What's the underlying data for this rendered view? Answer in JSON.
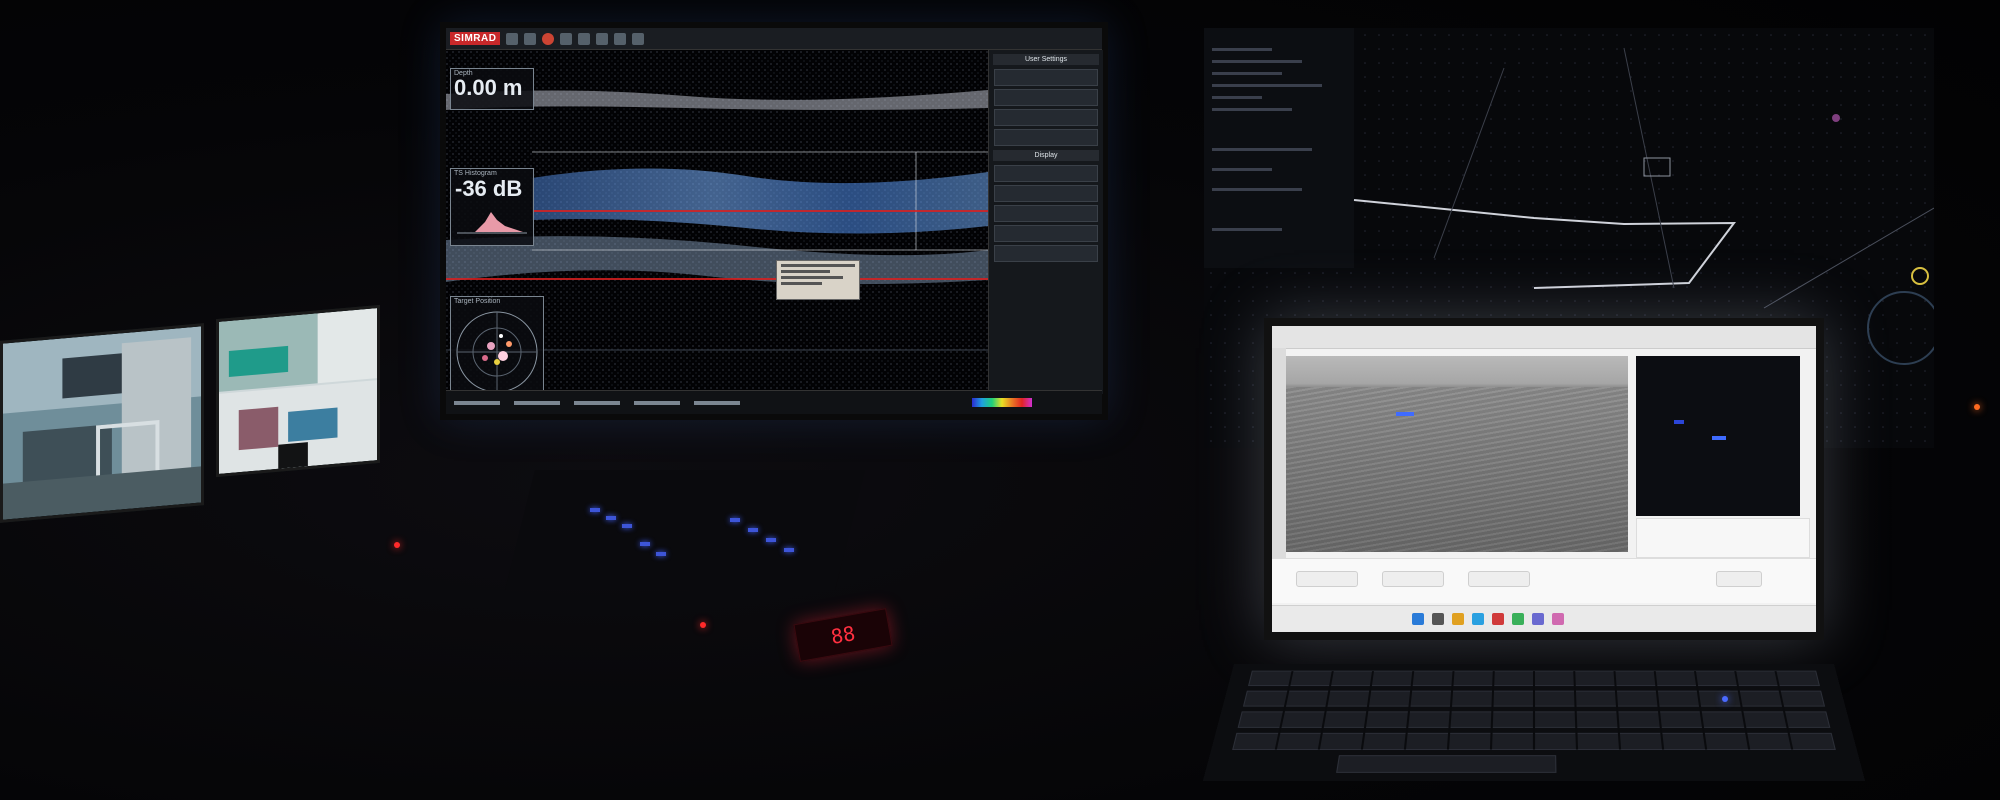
{
  "scene": {
    "description_tag": "",
    "background_color": "#040406"
  },
  "echosounder": {
    "brand_label": "SIMRAD",
    "depth": {
      "label": "Depth",
      "value": "0.00 m"
    },
    "ts_histogram": {
      "label": "TS Histogram",
      "value": "-36 dB"
    },
    "target_position": {
      "label": "Target Position"
    },
    "right_panel": {
      "title": "User Settings",
      "display_title": "Display"
    },
    "accent_colors": {
      "echo_blue": "#5aa0ff",
      "bottom_red": "#d82020",
      "brand_red": "#c8282a"
    }
  },
  "console_display": {
    "value": "88"
  },
  "laptop": {
    "app_colors": {
      "thermal_bg": "#0c0d12",
      "blip_blue": "#3f6bff"
    }
  }
}
